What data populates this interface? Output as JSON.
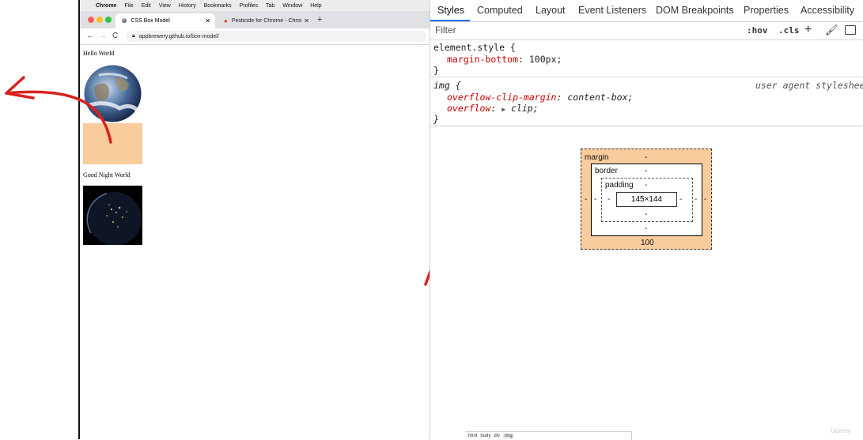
{
  "menubar": {
    "app": "Chrome",
    "items": [
      "File",
      "Edit",
      "View",
      "History",
      "Bookmarks",
      "Profiles",
      "Tab",
      "Window",
      "Help"
    ]
  },
  "browser": {
    "tabs": [
      {
        "label": "CSS Box Model"
      },
      {
        "label": "Pesticide for Chrome - Chrome"
      }
    ],
    "url": "appbrewery.github.io/box-model/"
  },
  "page": {
    "heading1": "Hello World",
    "heading2": "Good Night World"
  },
  "devtools": {
    "tabs": [
      "Styles",
      "Computed",
      "Layout",
      "Event Listeners",
      "DOM Breakpoints",
      "Properties",
      "Accessibility"
    ],
    "filter_placeholder": "Filter",
    "hov": ":hov",
    "cls": ".cls",
    "rules": [
      {
        "selector": "element.style {",
        "props": [
          {
            "name": "margin-bottom",
            "value": "100px;"
          }
        ],
        "close": "}"
      },
      {
        "selector": "img {",
        "origin": "user agent stylesheet",
        "props": [
          {
            "name": "overflow-clip-margin",
            "value": "content-box;"
          },
          {
            "name": "overflow",
            "value": "clip;"
          }
        ],
        "close": "}"
      }
    ],
    "box_model": {
      "margin_label": "margin",
      "border_label": "border",
      "padding_label": "padding",
      "content_size": "145×144",
      "dash": "-",
      "margin_bottom": "100"
    },
    "breadcrumb": [
      "html",
      "body",
      "div",
      "img"
    ]
  },
  "watermark": "Udemy",
  "colors": {
    "margin_highlight": "#f9cc9d",
    "annotation_arrow": "#d8231f",
    "active_tab": "#1a73e8"
  }
}
